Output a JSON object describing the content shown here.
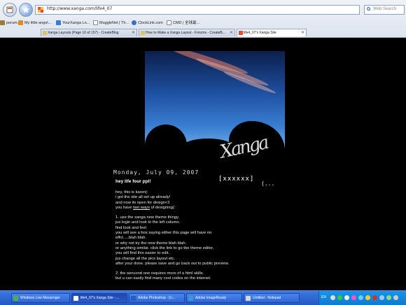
{
  "browser": {
    "url": "http://www.xanga.com/life4_07",
    "search_placeholder": "Web Search",
    "bookmarks": [
      {
        "label": "porum...",
        "color": "#9a7a3a"
      },
      {
        "label": "My little angel...",
        "color": "#e08a2a"
      },
      {
        "label": "YourXanga Lo...",
        "color": "#3a7ad0"
      },
      {
        "label": "MuggleNet | Th...",
        "color": "#ffffff"
      },
      {
        "label": "ClockLink.com",
        "color": "#3a70c0"
      },
      {
        "label": "CMD | 全球最...",
        "color": "#ffffff"
      }
    ],
    "tabs": [
      {
        "label": "Xanga Layouts (Page 10 of 157) - CreateBlog"
      },
      {
        "label": "How to Make a Xanga Layout - Forums - CreateB..."
      },
      {
        "label": "life4_07's Xanga Site",
        "active": true
      }
    ]
  },
  "page": {
    "site_title": "[xxxxxx]",
    "ellipsis": "(...",
    "logo_text": "Xanga",
    "post_date": "Monday, July 09, 2007",
    "post_title": "hey life four ppl!",
    "body": [
      "hey, this is karen(:",
      "i got the site all set up already!",
      "and now its open for design<3",
      "you have two ways of designing(:",
      "",
      "1. use the xanga new theme thingy.",
      "jus login and look to the left column.",
      "find look and feel.",
      "you will see a box saying either this page will have no",
      "effct.....blah blah.",
      "or why not try the new theme blah blah.",
      "or anything similar. click the link to go the theme editor.",
      "you will find this easier to edit.",
      "jus change all the pics layout etc.",
      "after your done. please save and go back out to public preview.",
      "",
      "2. the sencond one requires more of a html skills.",
      "but u can easily find many cool codes on the internet."
    ],
    "body_underline_phrase": "two ways"
  },
  "taskbar": {
    "tasks": [
      {
        "label": "Windows Live Messenger",
        "color": "#4ab04a"
      },
      {
        "label": "life4_07's Xanga Site - ...",
        "color": "#ffffff",
        "active": true
      },
      {
        "label": "Adobe Photoshop - [Li...",
        "color": "#2a5cc0"
      },
      {
        "label": "Adobe ImageReady",
        "color": "#3a9ad0"
      },
      {
        "label": "Untitled - Notepad",
        "color": "#d8d8d8"
      }
    ],
    "lang": "EN"
  }
}
